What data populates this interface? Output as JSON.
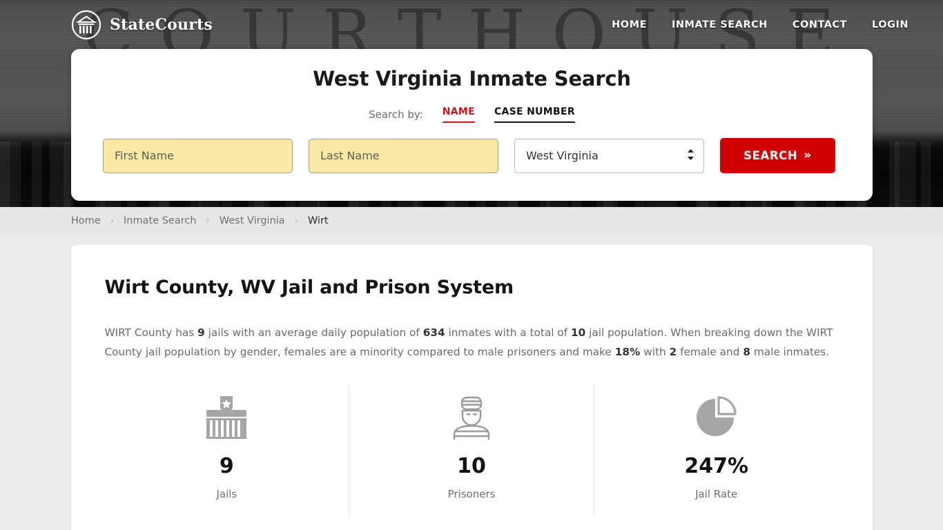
{
  "header": {
    "brand_name": "StateCourts",
    "brand_icon": "courthouse-circle-icon",
    "nav": [
      {
        "label": "HOME"
      },
      {
        "label": "INMATE SEARCH"
      },
      {
        "label": "CONTACT"
      },
      {
        "label": "LOGIN"
      }
    ],
    "background_watermark": "COURTHOUSE"
  },
  "search": {
    "title": "West Virginia Inmate Search",
    "search_by_label": "Search by:",
    "tabs": [
      {
        "label": "NAME",
        "active": true
      },
      {
        "label": "CASE NUMBER",
        "active": false
      }
    ],
    "first_name": {
      "value": "",
      "placeholder": "First Name"
    },
    "last_name": {
      "value": "",
      "placeholder": "Last Name"
    },
    "state_select": {
      "value": "West Virginia",
      "options": [
        "West Virginia"
      ]
    },
    "submit_label": "SEARCH",
    "submit_chevron": "»",
    "accent_red": "#d10000",
    "active_tab_red": "#c7161d",
    "field_highlight": "#fbe9a6"
  },
  "breadcrumb": {
    "separator": "›",
    "items": [
      {
        "label": "Home",
        "current": false
      },
      {
        "label": "Inmate Search",
        "current": false
      },
      {
        "label": "West Virginia",
        "current": false
      },
      {
        "label": "Wirt",
        "current": true
      }
    ]
  },
  "main": {
    "heading": "Wirt County, WV Jail and Prison System",
    "summary": {
      "part1": "WIRT County has ",
      "jails": "9",
      "part2": " jails with an average daily population of ",
      "adp": "634",
      "part3": " inmates with a total of ",
      "total": "10",
      "part4": " jail population. When breaking down the WIRT County jail population by gender, females are a minority compared to male prisoners and make ",
      "female_pct": "18%",
      "part5": " with ",
      "female": "2",
      "part6": " female and ",
      "male": "8",
      "part7": " male inmates."
    },
    "stats": [
      {
        "value": "9",
        "label": "Jails",
        "icon": "jail-building-icon"
      },
      {
        "value": "10",
        "label": "Prisoners",
        "icon": "prisoner-icon"
      },
      {
        "value": "247%",
        "label": "Jail Rate",
        "icon": "pie-chart-icon"
      }
    ]
  }
}
